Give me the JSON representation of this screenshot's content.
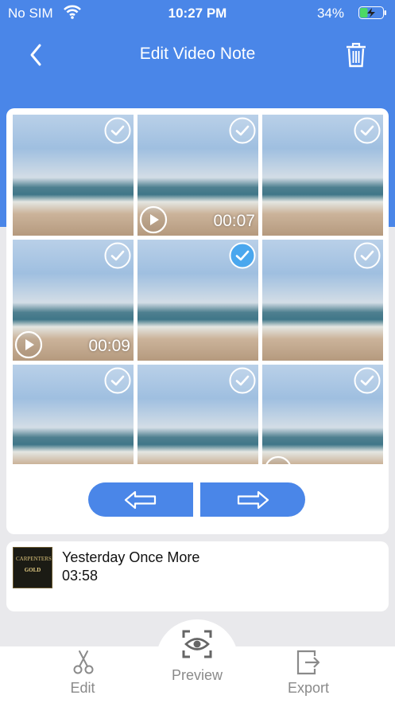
{
  "status_bar": {
    "carrier": "No SIM",
    "time": "10:27 PM",
    "battery_percent": "34%",
    "battery_level": 0.34,
    "icons": [
      "wifi-icon",
      "battery-charging-icon"
    ]
  },
  "navbar": {
    "title": "Edit Video Note",
    "back_icon": "chevron-left-icon",
    "delete_icon": "trash-icon"
  },
  "colors": {
    "accent": "#4a86e8",
    "selected_check": "#4aa7ee",
    "background": "#e9e9ec"
  },
  "grid": {
    "items": [
      {
        "type": "photo",
        "selected": false,
        "duration": ""
      },
      {
        "type": "video",
        "selected": false,
        "duration": "00:07"
      },
      {
        "type": "photo",
        "selected": false,
        "duration": ""
      },
      {
        "type": "video",
        "selected": false,
        "duration": "00:09"
      },
      {
        "type": "photo",
        "selected": true,
        "duration": ""
      },
      {
        "type": "photo",
        "selected": false,
        "duration": ""
      },
      {
        "type": "photo",
        "selected": false,
        "duration": ""
      },
      {
        "type": "photo",
        "selected": false,
        "duration": ""
      },
      {
        "type": "video",
        "selected": false,
        "duration": ""
      }
    ]
  },
  "nav_arrows": {
    "left_icon": "arrow-left-icon",
    "right_icon": "arrow-right-icon"
  },
  "music": {
    "song_title": "Yesterday Once More",
    "duration": "03:58",
    "album_art_text": [
      "CARPENTERS",
      "GOLD"
    ]
  },
  "tabbar": {
    "tabs": [
      {
        "label": "Edit",
        "icon": "scissors-icon"
      },
      {
        "label": "Preview",
        "icon": "eye-scan-icon"
      },
      {
        "label": "Export",
        "icon": "export-icon"
      }
    ]
  }
}
